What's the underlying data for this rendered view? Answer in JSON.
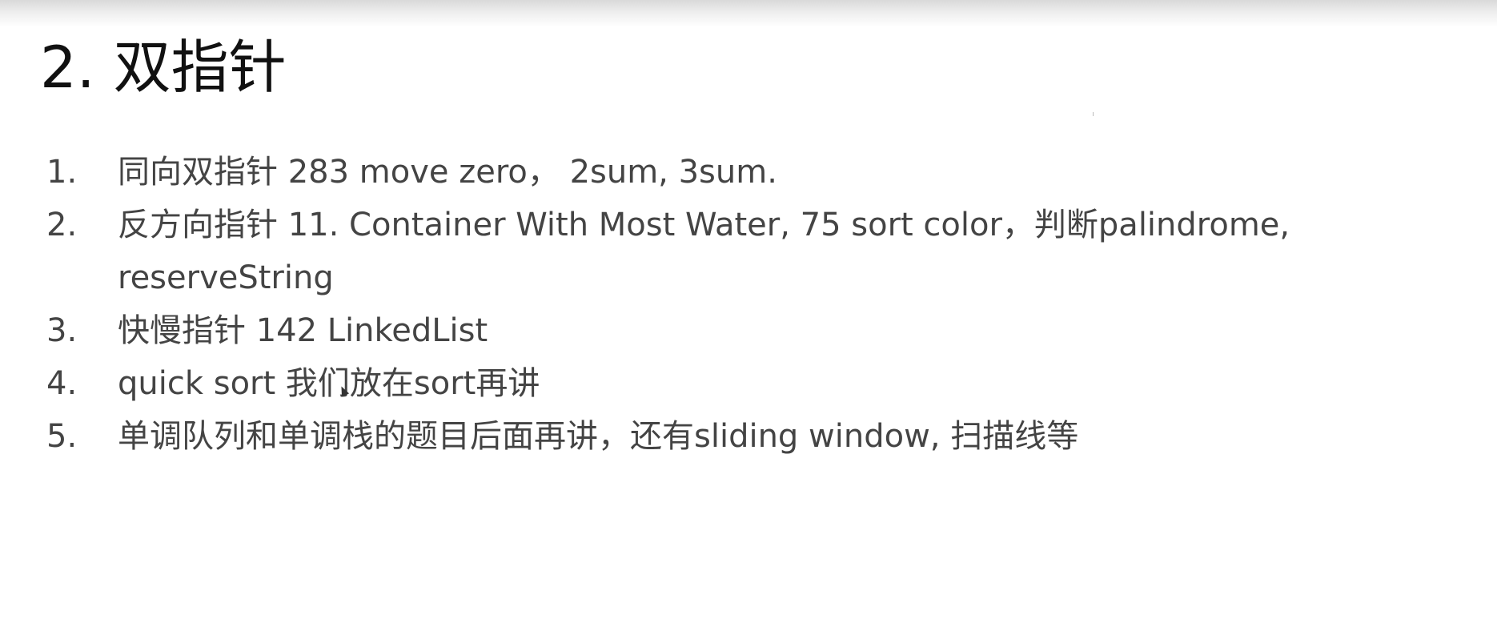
{
  "slide": {
    "title": "2. 双指针",
    "items": [
      {
        "number": "1.",
        "text": "同向双指针 283 move zero， 2sum, 3sum."
      },
      {
        "number": "2.",
        "text": "反方向指针 11. Container With Most Water, 75 sort color，判断palindrome, reserveString"
      },
      {
        "number": "3.",
        "text": "快慢指针 142 LinkedList"
      },
      {
        "number": "4.",
        "text": "quick sort 我们放在sort再讲"
      },
      {
        "number": "5.",
        "text": "单调队列和单调栈的题目后面再讲，还有sliding window, 扫描线等"
      }
    ]
  },
  "colors": {
    "title": "#111111",
    "body_text": "#444444",
    "background": "#ffffff"
  }
}
